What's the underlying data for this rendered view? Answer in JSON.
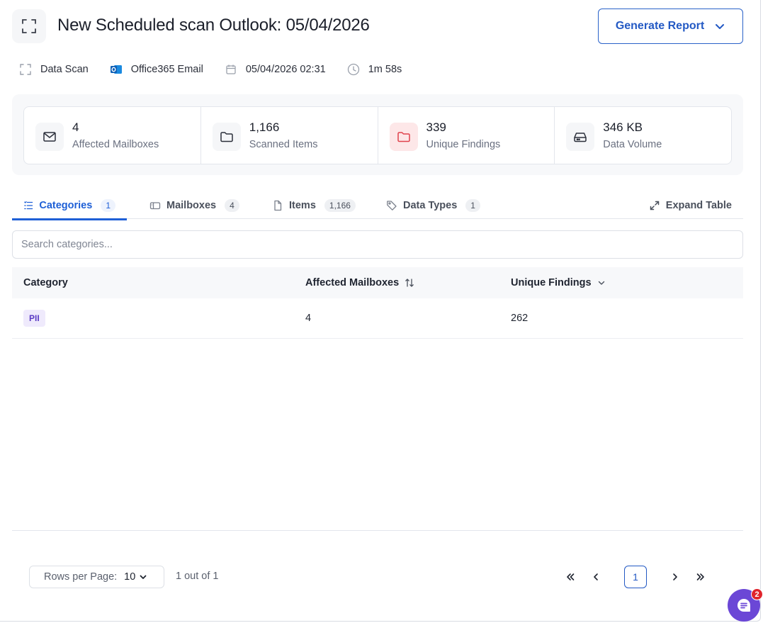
{
  "header": {
    "title": "New Scheduled scan Outlook: 05/04/2026",
    "generate_report_label": "Generate Report"
  },
  "meta": {
    "scan_type": "Data Scan",
    "source": "Office365 Email",
    "datetime": "05/04/2026 02:31",
    "duration": "1m 58s"
  },
  "stats": [
    {
      "value": "4",
      "label": "Affected Mailboxes",
      "icon": "mail-icon"
    },
    {
      "value": "1,166",
      "label": "Scanned Items",
      "icon": "folder-icon"
    },
    {
      "value": "339",
      "label": "Unique Findings",
      "icon": "folder-alert-icon"
    },
    {
      "value": "346 KB",
      "label": "Data Volume",
      "icon": "hard-drive-icon"
    }
  ],
  "tabs": [
    {
      "label": "Categories",
      "count": "1"
    },
    {
      "label": "Mailboxes",
      "count": "4"
    },
    {
      "label": "Items",
      "count": "1,166"
    },
    {
      "label": "Data Types",
      "count": "1"
    }
  ],
  "expand_label": "Expand Table",
  "search": {
    "placeholder": "Search categories..."
  },
  "table": {
    "columns": [
      "Category",
      "Affected Mailboxes",
      "Unique Findings"
    ],
    "rows": [
      {
        "category": "PII",
        "affected_mailboxes": "4",
        "unique_findings": "262"
      }
    ]
  },
  "pagination": {
    "rows_per_page_label": "Rows per Page:",
    "rows_per_page_value": "10",
    "page_info": "1 out of 1",
    "current_page": "1"
  },
  "chat": {
    "badge_count": "2"
  },
  "colors": {
    "accent": "#1e5fd6",
    "badge_red": "#e0242c",
    "chat_purple": "#6b47d6"
  }
}
